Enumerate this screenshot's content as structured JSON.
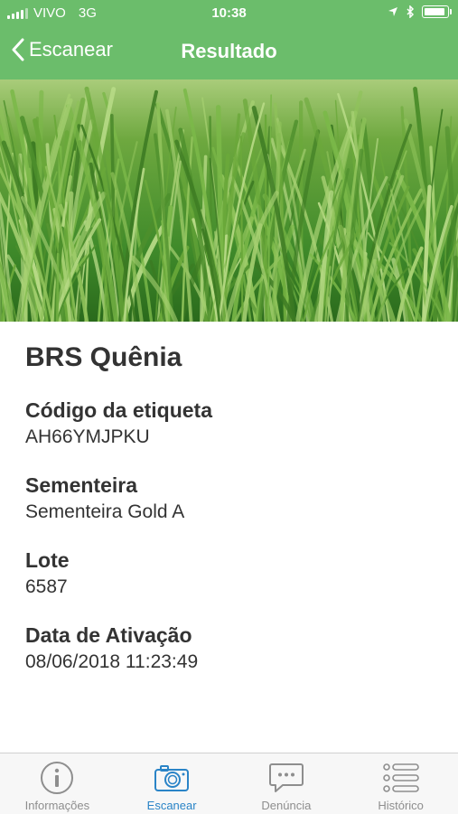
{
  "status_bar": {
    "carrier": "VIVO",
    "network": "3G",
    "time": "10:38"
  },
  "nav": {
    "back_label": "Escanear",
    "title": "Resultado"
  },
  "product": {
    "name": "BRS Quênia",
    "fields": [
      {
        "label": "Código da etiqueta",
        "value": "AH66YMJPKU"
      },
      {
        "label": "Sementeira",
        "value": "Sementeira Gold A"
      },
      {
        "label": "Lote",
        "value": "6587"
      },
      {
        "label": "Data de Ativação",
        "value": "08/06/2018 11:23:49"
      }
    ]
  },
  "tabs": [
    {
      "label": "Informações",
      "icon": "info-icon",
      "active": false
    },
    {
      "label": "Escanear",
      "icon": "camera-icon",
      "active": true
    },
    {
      "label": "Denúncia",
      "icon": "chat-bubble-icon",
      "active": false
    },
    {
      "label": "Histórico",
      "icon": "list-icon",
      "active": false
    }
  ],
  "colors": {
    "header": "#6bbd6b",
    "tab_active": "#2a84c7",
    "tab_inactive": "#8e8e8e"
  }
}
